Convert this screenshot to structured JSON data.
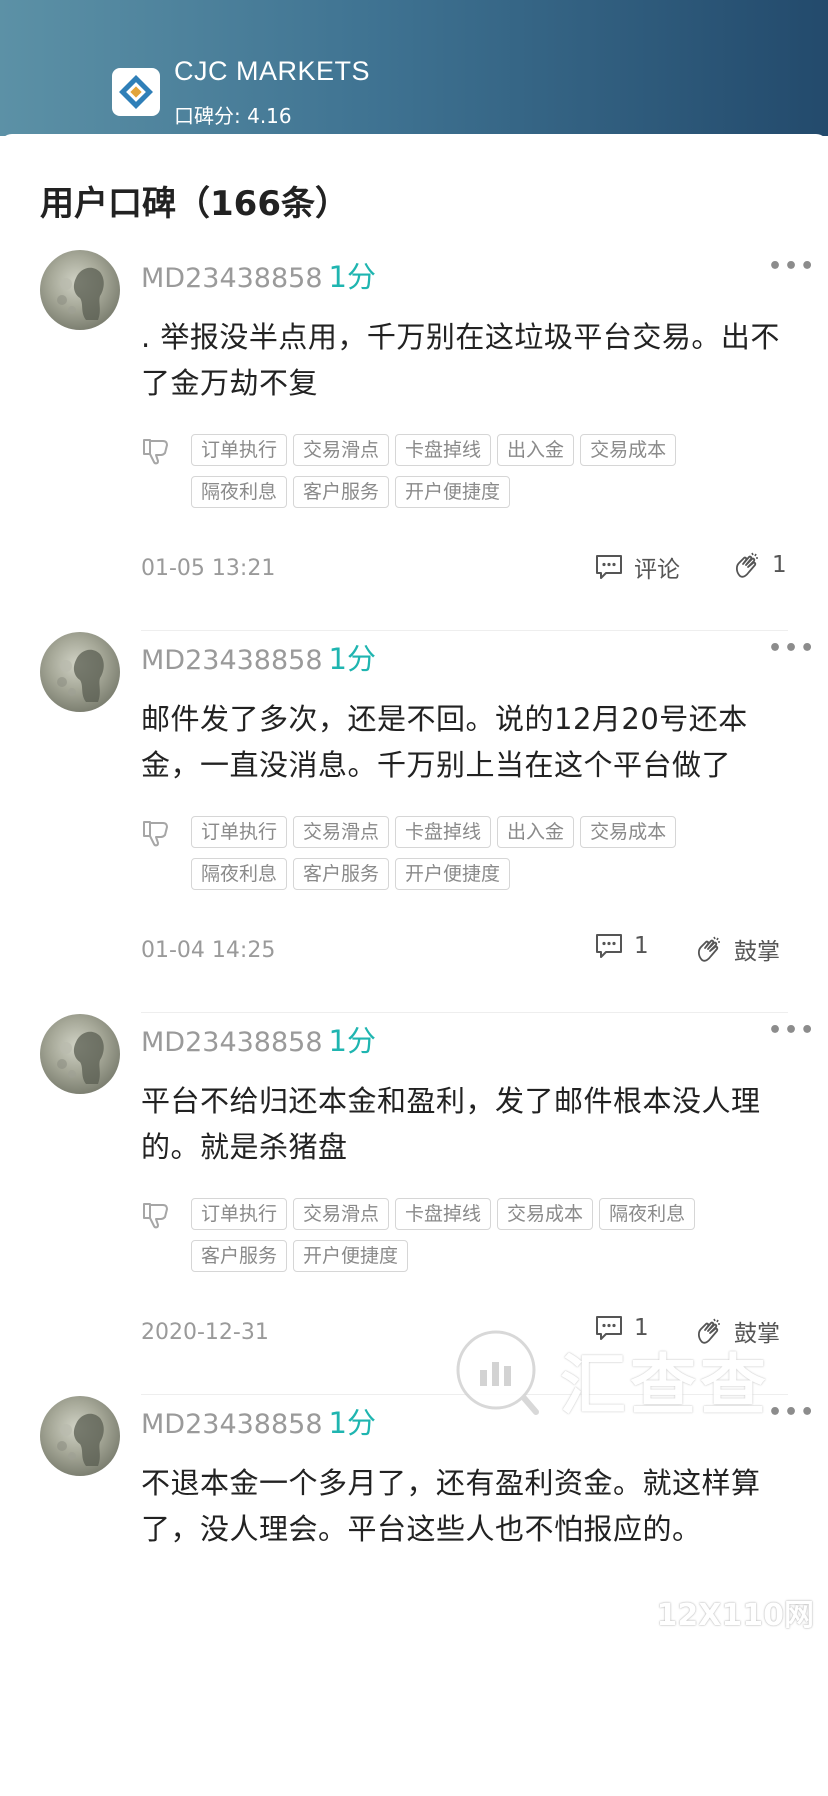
{
  "header": {
    "app_name": "CJC MARKETS",
    "score_text": "口碑分: 4.16"
  },
  "section": {
    "title": "用户口碑（166条）"
  },
  "colors": {
    "accent": "#1fb5b0",
    "header_start": "#5c91a6",
    "header_end": "#234a6c"
  },
  "reviews": [
    {
      "user": "MD23438858",
      "score": "1分",
      "content": ".  举报没半点用，千万别在这垃圾平台交易。出不了金万劫不复",
      "tags": [
        "订单执行",
        "交易滑点",
        "卡盘掉线",
        "出入金",
        "交易成本",
        "隔夜利息",
        "客户服务",
        "开户便捷度"
      ],
      "date": "01-05 13:21",
      "comment": "评论",
      "clap": "1"
    },
    {
      "user": "MD23438858",
      "score": "1分",
      "content": "邮件发了多次，还是不回。说的12月20号还本金，一直没消息。千万别上当在这个平台做了",
      "tags": [
        "订单执行",
        "交易滑点",
        "卡盘掉线",
        "出入金",
        "交易成本",
        "隔夜利息",
        "客户服务",
        "开户便捷度"
      ],
      "date": "01-04 14:25",
      "comment": "1",
      "clap": "鼓掌"
    },
    {
      "user": "MD23438858",
      "score": "1分",
      "content": "平台不给归还本金和盈利，发了邮件根本没人理的。就是杀猪盘",
      "tags": [
        "订单执行",
        "交易滑点",
        "卡盘掉线",
        "交易成本",
        "隔夜利息",
        "客户服务",
        "开户便捷度"
      ],
      "date": "2020-12-31",
      "comment": "1",
      "clap": "鼓掌"
    },
    {
      "user": "MD23438858",
      "score": "1分",
      "content": "不退本金一个多月了，还有盈利资金。就这样算了，没人理会。平台这些人也不怕报应的。"
    }
  ],
  "icons": {
    "more": "more-icon",
    "thumb": "thumb-down-icon",
    "comment": "comment-icon",
    "clap": "clap-icon"
  },
  "watermark": {
    "text": "汇查查",
    "corner": "12X110网"
  }
}
